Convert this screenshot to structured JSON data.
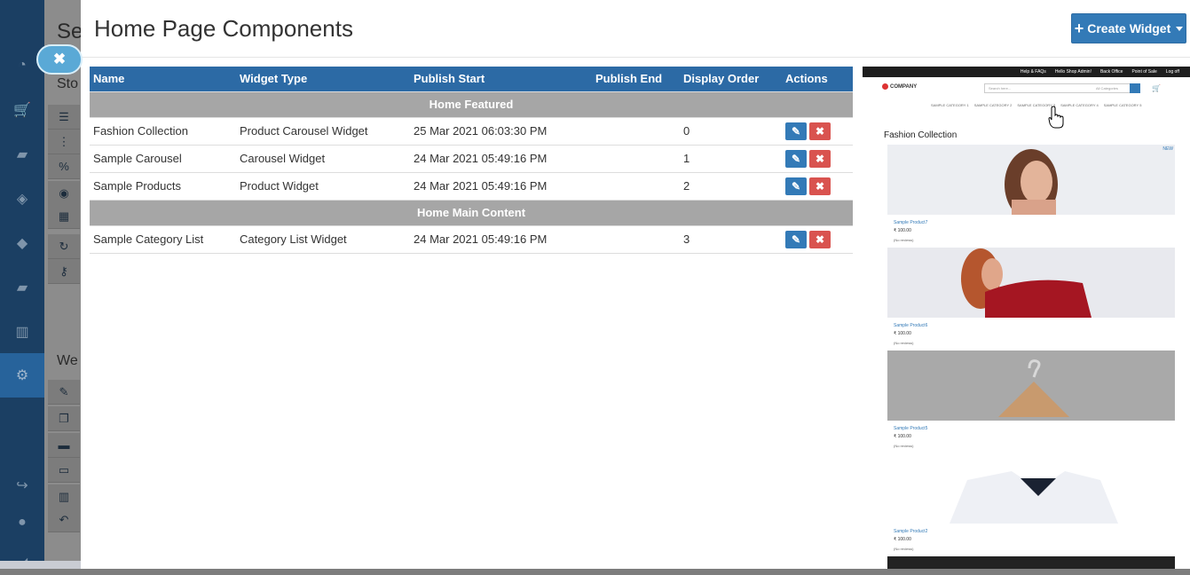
{
  "background_page": {
    "title_fragment": "Se",
    "section1_fragment": "Sto",
    "section2_fragment": "We"
  },
  "modal": {
    "title": "Home Page Components",
    "create_widget_label": "Create Widget"
  },
  "table": {
    "columns": [
      "Name",
      "Widget Type",
      "Publish Start",
      "Publish End",
      "Display Order",
      "Actions"
    ],
    "groups": [
      {
        "label": "Home Featured",
        "rows": [
          {
            "name": "Fashion Collection",
            "type": "Product Carousel Widget",
            "start": "25 Mar 2021 06:03:30 PM",
            "end": "",
            "order": "0"
          },
          {
            "name": "Sample Carousel",
            "type": "Carousel Widget",
            "start": "24 Mar 2021 05:49:16 PM",
            "end": "",
            "order": "1"
          },
          {
            "name": "Sample Products",
            "type": "Product Widget",
            "start": "24 Mar 2021 05:49:16 PM",
            "end": "",
            "order": "2"
          }
        ]
      },
      {
        "label": "Home Main Content",
        "rows": [
          {
            "name": "Sample Category List",
            "type": "Category List Widget",
            "start": "24 Mar 2021 05:49:16 PM",
            "end": "",
            "order": "3"
          }
        ]
      }
    ]
  },
  "preview": {
    "top_links": [
      "Help & FAQs",
      "Hello Shop Admin!",
      "Back Office",
      "Point of Sale",
      "Log off"
    ],
    "logo": "COMPANY",
    "search_placeholder": "Search here...",
    "category_select": "All Categories",
    "categories": [
      "SAMPLE CATEGORY 1",
      "SAMPLE CATEGORY 2",
      "SAMPLE CATEGORY 3",
      "SAMPLE CATEGORY 4",
      "SAMPLE CATEGORY 5"
    ],
    "section_title": "Fashion Collection",
    "new_badge": "NEW",
    "products": [
      {
        "name": "Sample Product7",
        "price": "₹ 100.00",
        "reviews": "(No reviews)"
      },
      {
        "name": "Sample Product6",
        "price": "₹ 100.00",
        "reviews": "(No reviews)"
      },
      {
        "name": "Sample Product5",
        "price": "₹ 100.00",
        "reviews": "(No reviews)"
      },
      {
        "name": "Sample Product2",
        "price": "₹ 100.00",
        "reviews": "(No reviews)"
      }
    ]
  },
  "colors": {
    "primary": "#337ab7",
    "danger": "#d9534f",
    "header": "#2c6aa5",
    "group_row": "#a6a6a6",
    "nav": "#1b3f63"
  }
}
